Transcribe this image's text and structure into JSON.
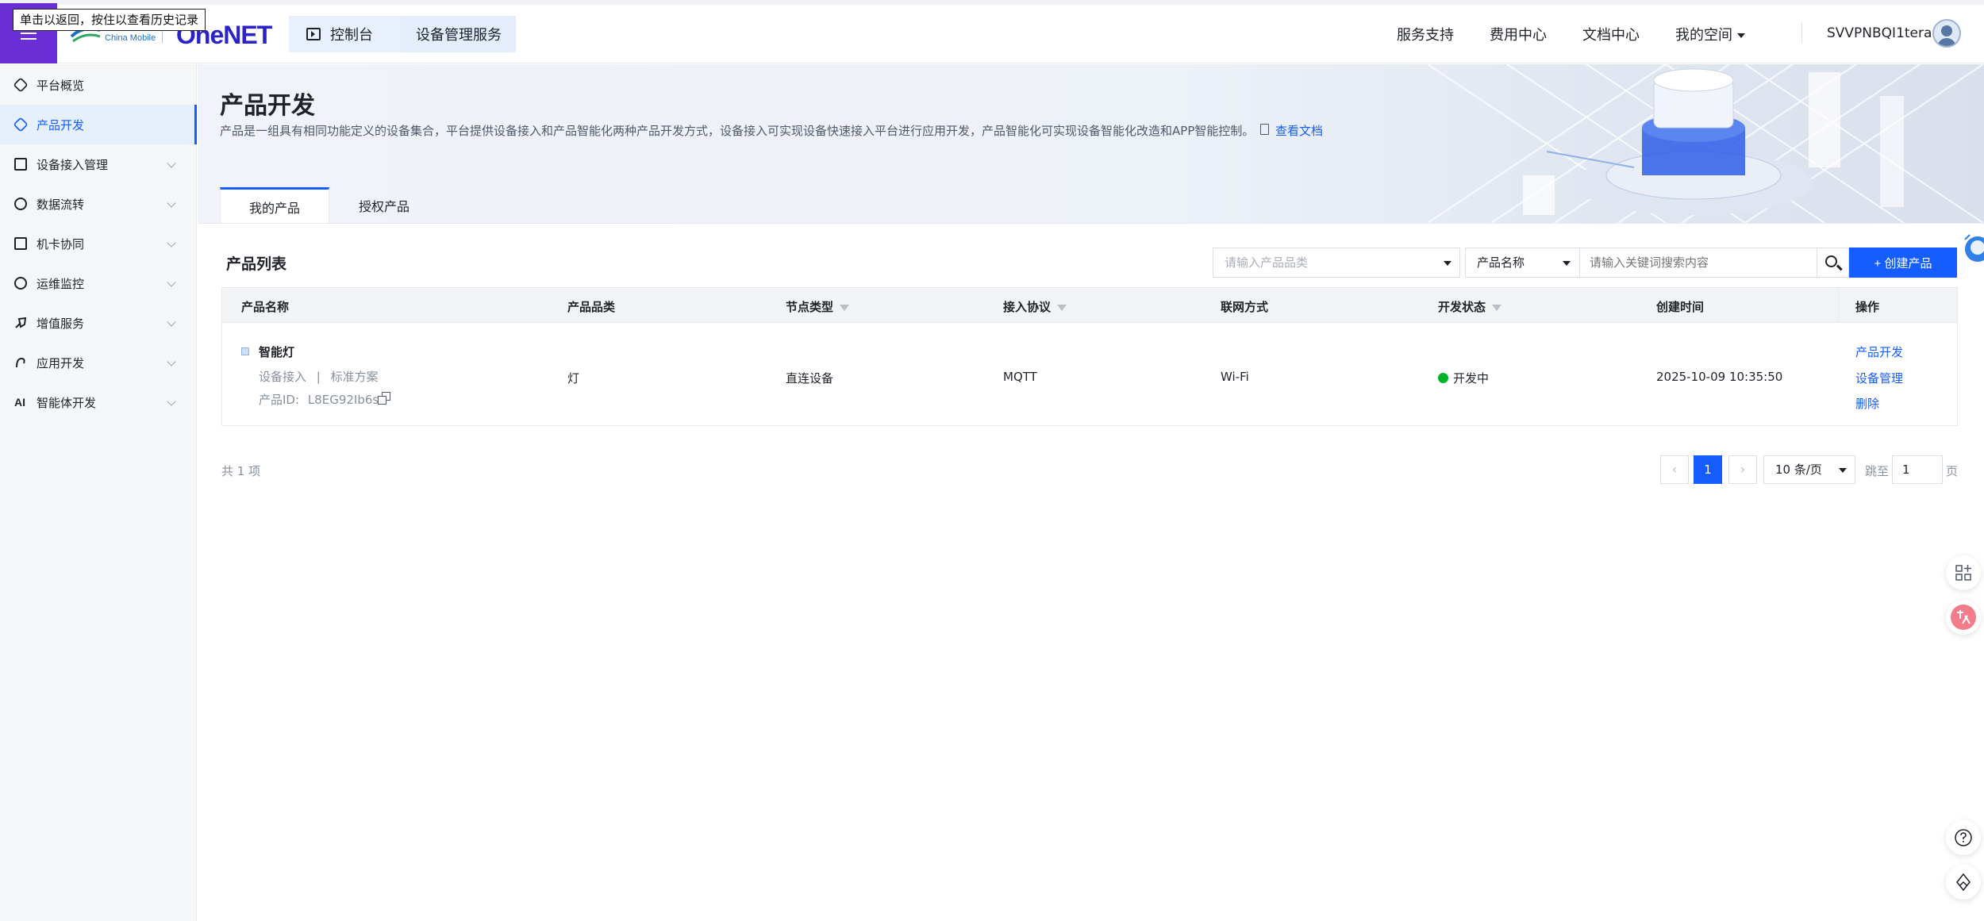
{
  "tooltip": "单击以返回，按住以查看历史记录",
  "logo": {
    "cm_text": "China Mobile",
    "product": "OneNET"
  },
  "breadcrumb": [
    {
      "label": "控制台"
    },
    {
      "label": "设备管理服务"
    }
  ],
  "topnav": {
    "items": [
      "服务支持",
      "费用中心",
      "文档中心",
      "我的空间"
    ],
    "username": "SVVPNBQI1tera"
  },
  "sidebar": {
    "items": [
      {
        "label": "平台概览",
        "icon": "hexagon-icon",
        "active": false,
        "expandable": false
      },
      {
        "label": "产品开发",
        "icon": "cube-icon",
        "active": true,
        "expandable": false
      },
      {
        "label": "设备接入管理",
        "icon": "device-icon",
        "active": false,
        "expandable": true
      },
      {
        "label": "数据流转",
        "icon": "flow-icon",
        "active": false,
        "expandable": true
      },
      {
        "label": "机卡协同",
        "icon": "sim-icon",
        "active": false,
        "expandable": true
      },
      {
        "label": "运维监控",
        "icon": "monitor-icon",
        "active": false,
        "expandable": true
      },
      {
        "label": "增值服务",
        "icon": "rocket-icon",
        "active": false,
        "expandable": true
      },
      {
        "label": "应用开发",
        "icon": "app-icon",
        "active": false,
        "expandable": true
      },
      {
        "label": "智能体开发",
        "icon": "ai-icon",
        "active": false,
        "expandable": true
      }
    ]
  },
  "page": {
    "title": "产品开发",
    "description": "产品是一组具有相同功能定义的设备集合，平台提供设备接入和产品智能化两种产品开发方式，设备接入可实现设备快速接入平台进行应用开发，产品智能化可实现设备智能化改造和APP智能控制。",
    "doc_link": "查看文档",
    "tabs": [
      {
        "label": "我的产品",
        "active": true
      },
      {
        "label": "授权产品",
        "active": false
      }
    ]
  },
  "list": {
    "title": "产品列表",
    "category_placeholder": "请输入产品品类",
    "search_field": "产品名称",
    "search_placeholder": "请输入关键词搜索内容",
    "create_button": "+ 创建产品",
    "columns": [
      "产品名称",
      "产品品类",
      "节点类型",
      "接入协议",
      "联网方式",
      "开发状态",
      "创建时间",
      "操作"
    ],
    "rows": [
      {
        "name": "智能灯",
        "access": "设备接入",
        "divider": "|",
        "scheme": "标准方案",
        "id_label": "产品ID:",
        "id": "L8EG92Ib6s",
        "category": "灯",
        "node_type": "直连设备",
        "protocol": "MQTT",
        "network": "Wi-Fi",
        "status": "开发中",
        "created": "2025-10-09 10:35:50",
        "actions": [
          "产品开发",
          "设备管理",
          "删除"
        ]
      }
    ]
  },
  "pagination": {
    "total": "共 1 项",
    "prev": "‹",
    "current": "1",
    "next": "›",
    "page_size": "10 条/页",
    "jump_label": "跳至",
    "jump_value": "1",
    "page_unit": "页"
  },
  "colors": {
    "primary": "#165dff",
    "accent_purple": "#6a2ed6",
    "status_green": "#00b42a"
  }
}
